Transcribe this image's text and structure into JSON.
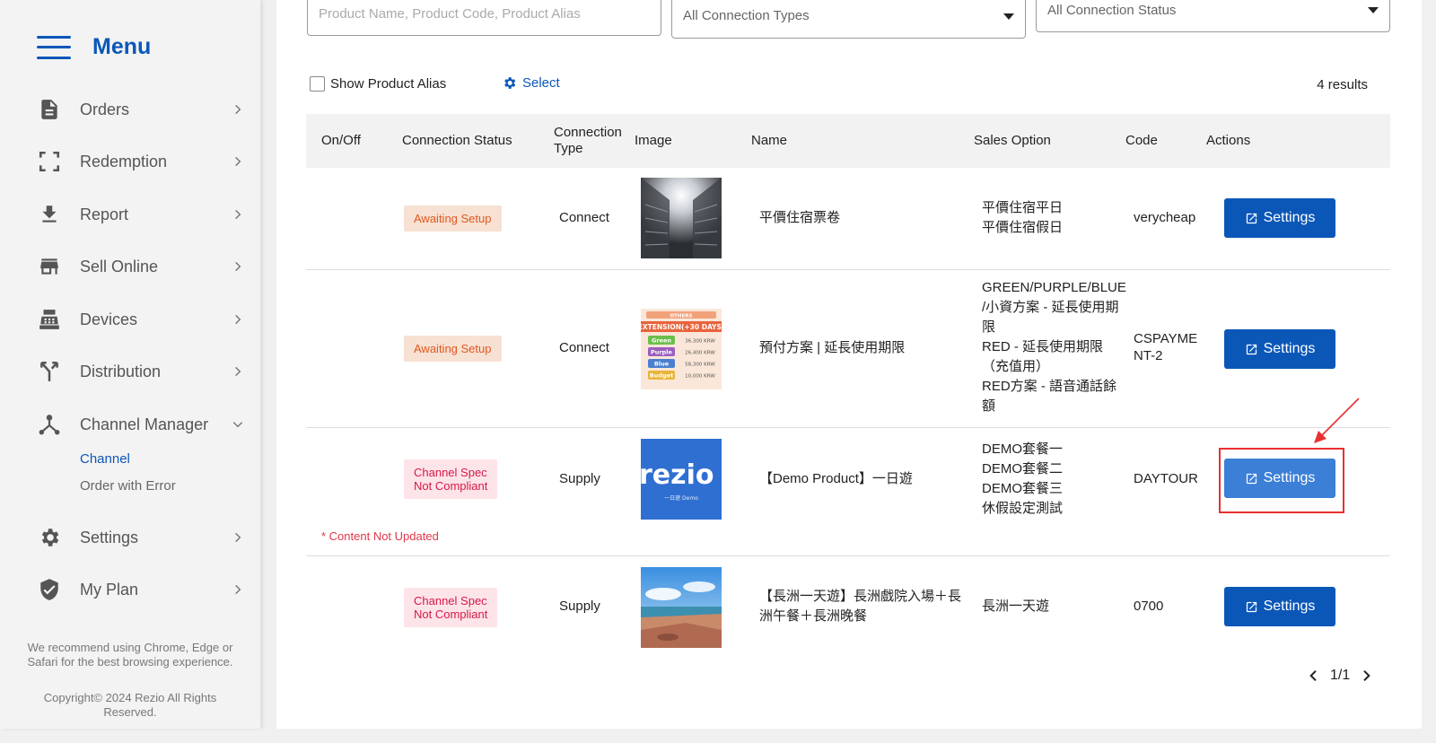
{
  "sidebar": {
    "title": "Menu",
    "items": [
      {
        "label": "Orders",
        "icon": "document-icon"
      },
      {
        "label": "Redemption",
        "icon": "scan-icon"
      },
      {
        "label": "Report",
        "icon": "download-icon"
      },
      {
        "label": "Sell Online",
        "icon": "store-icon"
      },
      {
        "label": "Devices",
        "icon": "cash-register-icon"
      },
      {
        "label": "Distribution",
        "icon": "split-arrow-icon"
      },
      {
        "label": "Channel Manager",
        "icon": "network-icon"
      },
      {
        "label": "Settings",
        "icon": "gear-icon"
      },
      {
        "label": "My Plan",
        "icon": "shield-check-icon"
      }
    ],
    "sub_items": [
      {
        "label": "Channel",
        "active": true
      },
      {
        "label": "Order with Error",
        "active": false
      }
    ],
    "browser_note": "We recommend using Chrome, Edge or Safari for the best browsing experience.",
    "copyright": "Copyright© 2024 Rezio All Rights Reserved."
  },
  "filters": {
    "search_placeholder": "Product Name, Product Code, Product Alias",
    "connection_types": "All Connection Types",
    "connection_status": "All Connection Status"
  },
  "toolbar": {
    "show_alias_label": "Show Product Alias",
    "select_label": "Select",
    "results": "4 results"
  },
  "table": {
    "headers": {
      "on_off": "On/Off",
      "status": "Connection Status",
      "type_line1": "Connection",
      "type_line2": "Type",
      "image": "Image",
      "name": "Name",
      "sales_option": "Sales Option",
      "code": "Code",
      "actions": "Actions"
    },
    "rows": [
      {
        "status": "Awaiting Setup",
        "type": "Connect",
        "name": "平價住宿票卷",
        "sales_options": [
          "平價住宿平日",
          "平價住宿假日"
        ],
        "code": "verycheap",
        "action": "Settings"
      },
      {
        "status": "Awaiting Setup",
        "type": "Connect",
        "name": "預付方案 | 延長使用期限",
        "sales_options": [
          "GREEN/PURPLE/BLUE",
          "/小資方案 - 延長使用期",
          "限",
          "RED - 延長使用期限",
          "（充值用）",
          "RED方案 - 語音通話餘",
          "額"
        ],
        "code_line1": "CSPAYME",
        "code_line2": "NT-2",
        "action": "Settings",
        "thumb_text": {
          "top": "OTHERS",
          "banner": "EXTENSION(+30 DAYS)",
          "rows": [
            {
              "label": "Green",
              "price": "36,300 KRW"
            },
            {
              "label": "Purple",
              "price": "26,400 KRW"
            },
            {
              "label": "Blue",
              "price": "58,300 KRW"
            },
            {
              "label": "Budget",
              "price": "10,000 KRW"
            }
          ]
        }
      },
      {
        "status_line1": "Channel Spec",
        "status_line2": "Not Compliant",
        "type": "Supply",
        "name": "【Demo Product】一日遊",
        "sales_options": [
          "DEMO套餐一",
          "DEMO套餐二",
          "DEMO套餐三",
          "休假設定測試"
        ],
        "code": "DAYTOUR",
        "action": "Settings",
        "warning": "* Content Not Updated",
        "thumb_brand": "rezio",
        "thumb_caption": "一日遊 Demo"
      },
      {
        "status_line1": "Channel Spec",
        "status_line2": "Not Compliant",
        "type": "Supply",
        "name_line1": "【長洲一天遊】長洲戲院入場＋長",
        "name_line2": "洲午餐＋長洲晚餐",
        "sales_options": [
          "長洲一天遊"
        ],
        "code": "0700",
        "action": "Settings"
      }
    ]
  },
  "pagination": {
    "label": "1/1"
  },
  "colors": {
    "primary": "#0b57b8",
    "awaiting_bg": "#f7e1d3",
    "awaiting_text": "#e0581f",
    "noncompliant_bg": "#fde4e8",
    "noncompliant_text": "#d6194a",
    "annotation": "#e8302f"
  }
}
